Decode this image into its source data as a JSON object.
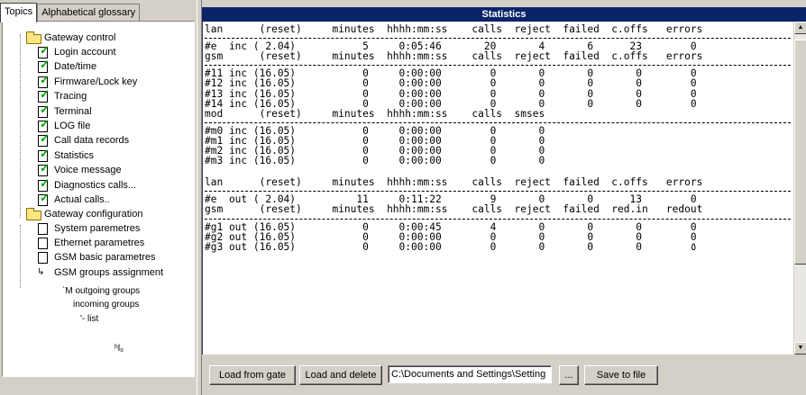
{
  "tabs": [
    "Topics",
    "Alphabetical glossary"
  ],
  "tree": {
    "gateway_control": "Gateway control",
    "control_items": [
      "Login account",
      "Date/time",
      "Firmware/Lock key",
      "Tracing",
      "Terminal",
      "LOG file",
      "Call data records",
      "Statistics",
      "Voice message",
      "Diagnostics calls...",
      "Actual calls.."
    ],
    "gateway_configuration": "Gateway configuration",
    "config_items": [
      "System paremetres",
      "Ethernet parametres",
      "GSM basic parametres",
      "GSM groups assignment"
    ],
    "sub_items": [
      "`M outgoing groups",
      "incoming groups",
      "'- list"
    ],
    "stray": "ʰl₉"
  },
  "statistics": {
    "title": "Statistics",
    "blocks": [
      {
        "lines": [
          "lan      (reset)     minutes  hhhh:mm:ss    calls  reject  failed  c.offs   errors"
        ]
      },
      {
        "lines": [
          "#e  inc ( 2.04)           5     0:05:46       20       4       6      23        0",
          "gsm      (reset)     minutes  hhhh:mm:ss    calls  reject  failed  c.offs   errors"
        ]
      },
      {
        "lines": [
          "#11 inc (16.05)           0     0:00:00        0       0       0       0        0",
          "#12 inc (16.05)           0     0:00:00        0       0       0       0        0",
          "#13 inc (16.05)           0     0:00:00        0       0       0       0        0",
          "#14 inc (16.05)           0     0:00:00        0       0       0       0        0",
          "mod      (reset)     minutes  hhhh:mm:ss    calls  smses"
        ]
      },
      {
        "lines": [
          "#m0 inc (16.05)           0     0:00:00        0       0",
          "#m1 inc (16.05)           0     0:00:00        0       0",
          "#m2 inc (16.05)           0     0:00:00        0       0",
          "#m3 inc (16.05)           0     0:00:00        0       0"
        ]
      },
      {
        "lines": [
          "lan      (reset)     minutes  hhhh:mm:ss    calls  reject  failed  c.offs   errors"
        ]
      },
      {
        "lines": [
          "#e  out ( 2.04)          11     0:11:22        9       0       0      13        0",
          "gsm      (reset)     minutes  hhhh:mm:ss    calls  reject  failed  red.in   redout"
        ]
      },
      {
        "lines": [
          "#g1 out (16.05)           0     0:00:45        4       0       0       0        0",
          "#g2 out (16.05)           0     0:00:00        0       0       0       0        0",
          "#g3 out (16.05)           0     0:00:00        0       0       0       0        ٥"
        ]
      }
    ]
  },
  "toolbar": {
    "load_from_gate": "Load from gate",
    "load_and_delete": "Load and delete",
    "path_value": "C:\\Documents and Settings\\Setting",
    "browse": "...",
    "save_to_file": "Save to file"
  }
}
